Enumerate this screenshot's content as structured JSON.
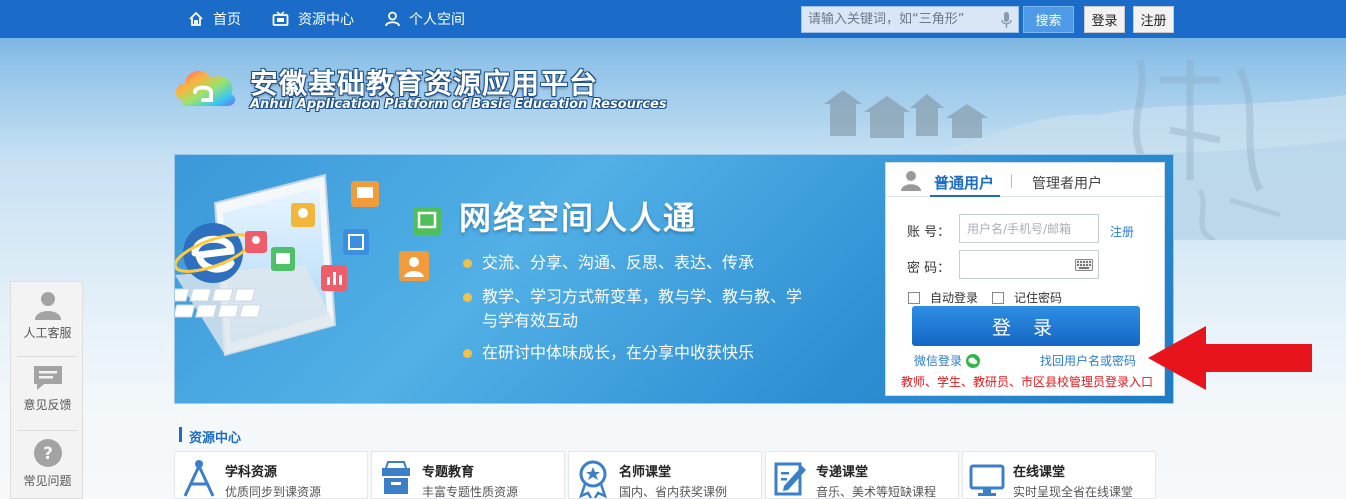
{
  "nav": {
    "items": [
      {
        "label": "首页",
        "icon": "home-icon"
      },
      {
        "label": "资源中心",
        "icon": "tv-icon"
      },
      {
        "label": "个人空间",
        "icon": "user-icon"
      }
    ],
    "search_placeholder": "请输入关键词，如“三角形”",
    "search_button": "搜索",
    "login_button": "登录",
    "register_button": "注册"
  },
  "header": {
    "title": "安徽基础教育资源应用平台",
    "subtitle": "Anhui Application Platform of Basic Education Resources"
  },
  "banner": {
    "title": "网络空间人人通",
    "bullets": [
      "交流、分享、沟通、反思、表达、传承",
      "教学、学习方式新变革，教与学、教与教、学与学有效互动",
      "在研讨中体味成长，在分享中收获快乐"
    ]
  },
  "login": {
    "tab_user": "普通用户",
    "tab_admin": "管理者用户",
    "account_label": "账 号：",
    "account_placeholder": "用户名/手机号/邮箱",
    "register_link": "注册",
    "password_label": "密 码：",
    "auto_login": "自动登录",
    "remember_password": "记住密码",
    "submit": "登 录",
    "wechat_login": "微信登录",
    "find_account": "找回用户名或密码",
    "entry_notice": "教师、学生、教研员、市区县校管理员登录入口"
  },
  "float_panel": {
    "items": [
      {
        "label": "人工客服",
        "icon": "customer-service-icon"
      },
      {
        "label": "意见反馈",
        "icon": "feedback-icon"
      },
      {
        "label": "常见问题",
        "icon": "question-icon"
      }
    ]
  },
  "resources": {
    "section_title": "资源中心",
    "items": [
      {
        "name": "学科资源",
        "desc": "优质同步到课资源",
        "icon": "subject-icon"
      },
      {
        "name": "专题教育",
        "desc": "丰富专题性质资源",
        "icon": "archive-icon"
      },
      {
        "name": "名师课堂",
        "desc": "国内、省内获奖课例",
        "icon": "medal-icon"
      },
      {
        "name": "专递课堂",
        "desc": "音乐、美术等短缺课程",
        "icon": "edit-icon"
      },
      {
        "name": "在线课堂",
        "desc": "实时呈现全省在线课堂",
        "icon": "monitor-icon"
      }
    ]
  },
  "colors": {
    "brand_blue": "#1b6cc8",
    "link_blue": "#2a7cd3",
    "alert_red": "#e0191c",
    "accent_yellow": "#f2c14a"
  }
}
